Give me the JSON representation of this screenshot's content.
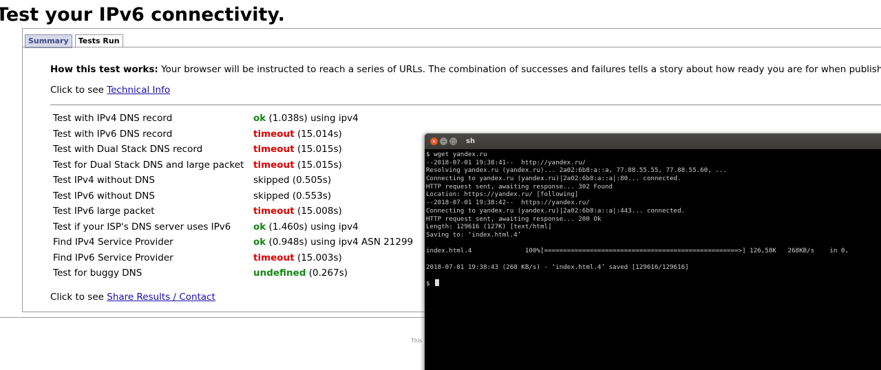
{
  "page": {
    "title": "Test your IPv6 connectivity."
  },
  "tabs": [
    {
      "label": "Summary"
    },
    {
      "label": "Tests Run"
    }
  ],
  "how": {
    "heading": "How this test works:",
    "text": " Your browser will be instructed to reach a series of URLs. The combination of successes and failures tells a story about how ready you are for when publishe"
  },
  "technical": {
    "prefix": "Click to see ",
    "link": "Technical Info"
  },
  "results": [
    {
      "label": "Test with IPv4 DNS record",
      "status": "ok",
      "detail": " (1.038s) using ipv4",
      "kind": "ok"
    },
    {
      "label": "Test with IPv6 DNS record",
      "status": "timeout",
      "detail": " (15.014s)",
      "kind": "timeout"
    },
    {
      "label": "Test with Dual Stack DNS record",
      "status": "timeout",
      "detail": " (15.015s)",
      "kind": "timeout"
    },
    {
      "label": "Test for Dual Stack DNS and large packet",
      "status": "timeout",
      "detail": " (15.015s)",
      "kind": "timeout"
    },
    {
      "label": "Test IPv4 without DNS",
      "status": "",
      "detail": "skipped (0.505s)",
      "kind": "plain"
    },
    {
      "label": "Test IPv6 without DNS",
      "status": "",
      "detail": "skipped (0.553s)",
      "kind": "plain"
    },
    {
      "label": "Test IPv6 large packet",
      "status": "timeout",
      "detail": " (15.008s)",
      "kind": "timeout"
    },
    {
      "label": "Test if your ISP's DNS server uses IPv6",
      "status": "ok",
      "detail": " (1.460s) using ipv4",
      "kind": "ok"
    },
    {
      "label": "Find IPv4 Service Provider",
      "status": "ok",
      "detail": " (0.948s) using ipv4 ASN 21299",
      "kind": "ok"
    },
    {
      "label": "Find IPv6 Service Provider",
      "status": "timeout",
      "detail": " (15.003s)",
      "kind": "timeout"
    },
    {
      "label": "Test for buggy DNS",
      "status": "undefined",
      "detail": " (0.267s)",
      "kind": "ok"
    }
  ],
  "share": {
    "prefix": "Click to see ",
    "link": "Share Results / Contact"
  },
  "footer": {
    "snippet": "This"
  },
  "terminal": {
    "title": "sh",
    "close_glyph": "×",
    "min_glyph": "−",
    "max_glyph": "□",
    "lines": [
      "$ wget yandex.ru",
      "--2018-07-01 19:38:41--  http://yandex.ru/",
      "Resolving yandex.ru (yandex.ru)... 2a02:6b8:a::a, 77.88.55.55, 77.88.55.60, ...",
      "Connecting to yandex.ru (yandex.ru)|2a02:6b8:a::a|:80... connected.",
      "HTTP request sent, awaiting response... 302 Found",
      "Location: https://yandex.ru/ [following]",
      "--2018-07-01 19:38:42--  https://yandex.ru/",
      "Connecting to yandex.ru (yandex.ru)|2a02:6b8:a::a|:443... connected.",
      "HTTP request sent, awaiting response... 200 Ok",
      "Length: 129616 (127K) [text/html]",
      "Saving to: ‘index.html.4’",
      "",
      "index.html.4              100%[===================================================>] 126,58K   268KB/s    in 0,",
      "",
      "2018-07-01 19:38:43 (268 KB/s) - ‘index.html.4’ saved [129616/129616]",
      "",
      "$ "
    ]
  }
}
